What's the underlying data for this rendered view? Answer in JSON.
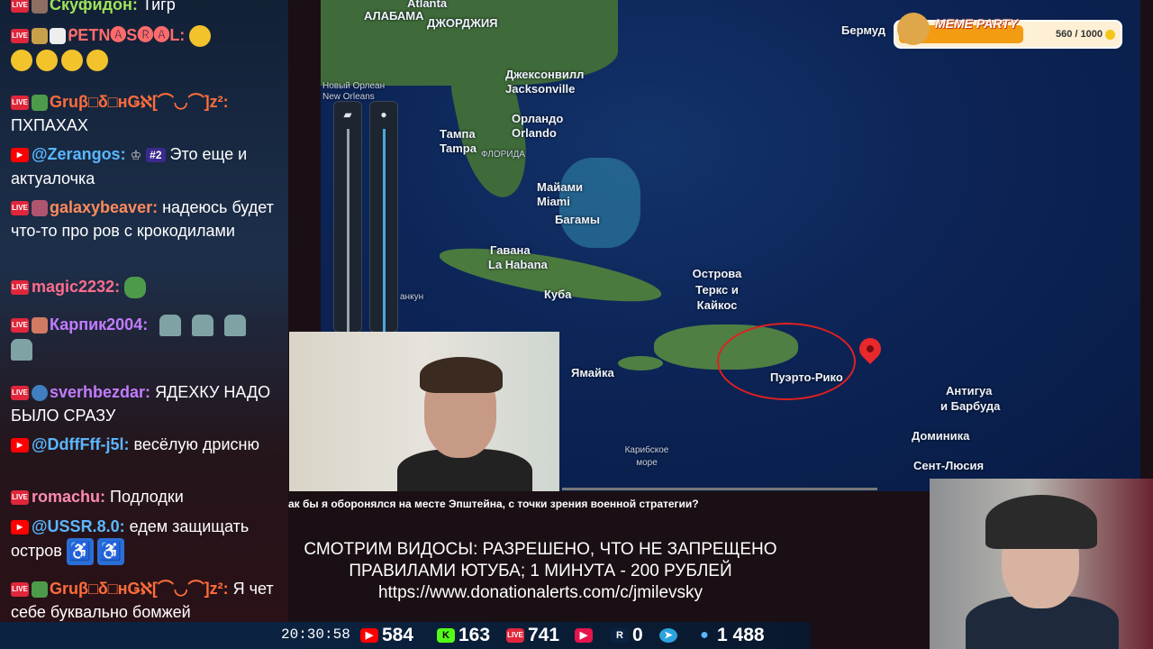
{
  "chat": {
    "messages": [
      {
        "user": "Скуфидон:",
        "text": "Тигр",
        "source": "live",
        "color": "#9ee35a"
      },
      {
        "user": "ᑭETN🅐S🅡🅐L:",
        "text": "",
        "source": "live",
        "color": "#ff6b6b",
        "emotes": 5
      },
      {
        "user": "Gruβ□δ□нǤℵ[⌒◡⌒]z²:",
        "text": "ПХПАХАХ",
        "source": "live",
        "color": "#ff6d3b"
      },
      {
        "user": "@Zerangos:",
        "text": "Это еще и актуалочка",
        "source": "youtube",
        "color": "#5ab7ff",
        "rank": "#2"
      },
      {
        "user": "galaxybeaver:",
        "text": "надеюсь будет что-то про ров с крокодилами",
        "source": "live",
        "color": "#ff8a5c"
      },
      {
        "user": "magic2232:",
        "text": "",
        "source": "live",
        "color": "#ff6d8d"
      },
      {
        "user": "Карпик2004:",
        "text": "",
        "source": "live",
        "color": "#c27cff"
      },
      {
        "user": "sverhbezdar:",
        "text": "ЯДЕХКУ НАДО БЫЛО СРАЗУ",
        "source": "live",
        "color": "#c27cff"
      },
      {
        "user": "@DdffFff-j5l:",
        "text": "весёлую дрисню",
        "source": "youtube",
        "color": "#5ab7ff"
      },
      {
        "user": "romachu:",
        "text": "Подлодки",
        "source": "live",
        "color": "#ff8ab0"
      },
      {
        "user": "@USSR.8.0:",
        "text": "едем защищать остров",
        "source": "youtube",
        "color": "#5ab7ff"
      },
      {
        "user": "Gruβ□δ□нǤℵ[⌒◡⌒]z²:",
        "text": "Я чет себе буквально бомжей представил",
        "source": "live",
        "color": "#ff6d3b"
      }
    ]
  },
  "map": {
    "labels": {
      "alabama": "АЛАБАМА",
      "georgia": "ДЖОРДЖИЯ",
      "atlanta": "Atlanta",
      "bermuda": "Бермуд",
      "new_orleans_ru": "Новый Орлеан",
      "new_orleans": "New Orleans",
      "jacksonville_ru": "Джексонвилл",
      "jacksonville": "Jacksonville",
      "orlando_ru": "Орландо",
      "orlando": "Orlando",
      "tampa_ru": "Тампа",
      "tampa": "Tampa",
      "florida": "ФЛОРИДА",
      "miami_ru": "Майами",
      "miami": "Miami",
      "bahamas": "Багамы",
      "havana_ru": "Гавана",
      "havana": "La Habana",
      "cuba": "Куба",
      "turks_1": "Острова",
      "turks_2": "Теркс и",
      "turks_3": "Кайкос",
      "cancun": "анкун",
      "jamaica": "Ямайка",
      "puerto_rico": "Пуэрто-Рико",
      "antigua_1": "Антигуа",
      "antigua_2": "и Барбуда",
      "dominica": "Доминика",
      "caribbean_1": "Карибское",
      "caribbean_2": "море",
      "st_lucia": "Сент-Люсия"
    },
    "video_title": "ак бы я оборонялся на месте Эпштейна, с точки зрения военной стратегии?"
  },
  "meme_party": {
    "title": "MEME PARTY",
    "progress_text": "560 / 1000",
    "progress": 0.56
  },
  "donation": {
    "line1": "СМОТРИМ ВИДОСЫ: РАЗРЕШЕНО, ЧТО НЕ ЗАПРЕЩЕНО",
    "line2": "ПРАВИЛАМИ ЮТУБА; 1 МИНУТА - 200 РУБЛЕЙ",
    "line3": "https://www.donationalerts.com/c/jmilevsky"
  },
  "stats": {
    "time": "20:30:58",
    "youtube": "584",
    "kick": "163",
    "vklive": "741",
    "rutube_icon": "",
    "rumble": "0",
    "telegram_icon": "",
    "users": "1 488"
  },
  "colors": {
    "live_badge": "#e0263b",
    "youtube_badge": "#ff0000",
    "pin": "#e8282b",
    "kick": "#53fc18"
  }
}
